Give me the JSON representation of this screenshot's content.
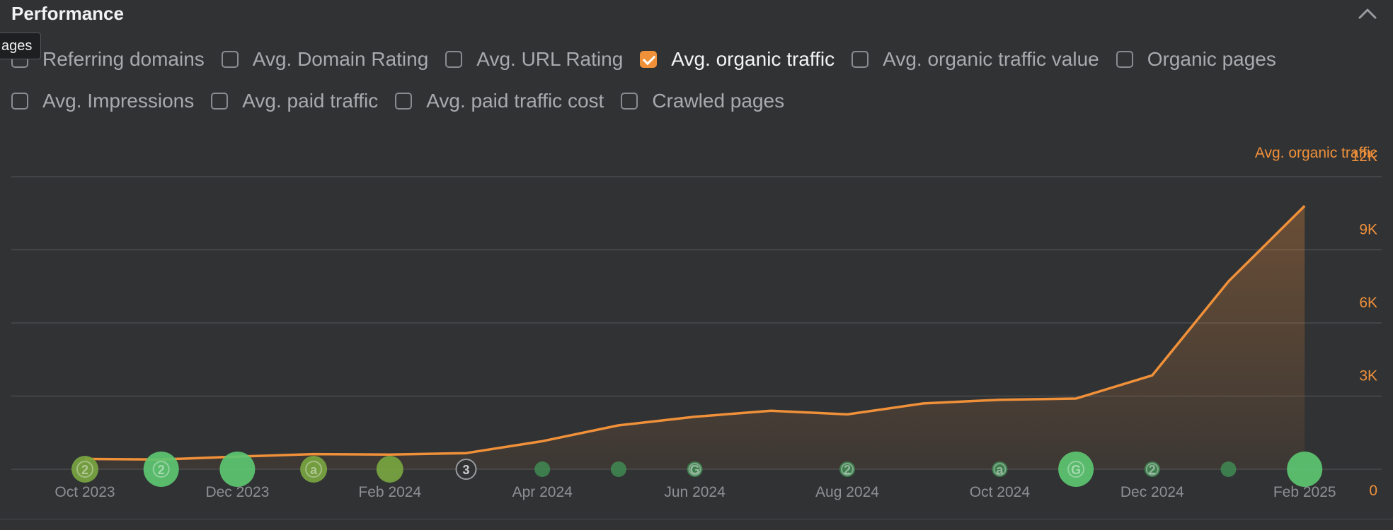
{
  "section": {
    "title": "Performance"
  },
  "tooltip_fragment": "ages",
  "metrics": [
    {
      "label": "Referring domains",
      "checked": false
    },
    {
      "label": "Avg. Domain Rating",
      "checked": false
    },
    {
      "label": "Avg. URL Rating",
      "checked": false
    },
    {
      "label": "Avg. organic traffic",
      "checked": true
    },
    {
      "label": "Avg. organic traffic value",
      "checked": false
    },
    {
      "label": "Organic pages",
      "checked": false
    },
    {
      "label": "Avg. Impressions",
      "checked": false
    },
    {
      "label": "Avg. paid traffic",
      "checked": false
    },
    {
      "label": "Avg. paid traffic cost",
      "checked": false
    },
    {
      "label": "Crawled pages",
      "checked": false
    }
  ],
  "colors": {
    "accent": "#f0913a",
    "marker_green": "#5cc571",
    "marker_dim_green": "#3f8a52",
    "marker_olive": "#77a540",
    "grid": "#4a4b4e",
    "axis_text": "#8e8f93"
  },
  "chart_data": {
    "type": "area",
    "series_name": "Avg. organic traffic",
    "x": [
      "Oct 2023",
      "Nov 2023",
      "Dec 2023",
      "Jan 2024",
      "Feb 2024",
      "Mar 2024",
      "Apr 2024",
      "May 2024",
      "Jun 2024",
      "Jul 2024",
      "Aug 2024",
      "Sep 2024",
      "Oct 2024",
      "Nov 2024",
      "Dec 2024",
      "Jan 2025",
      "Feb 2025"
    ],
    "x_tick_labels": [
      "Oct 2023",
      "Dec 2023",
      "Feb 2024",
      "Apr 2024",
      "Jun 2024",
      "Aug 2024",
      "Oct 2024",
      "Dec 2024",
      "Feb 2025"
    ],
    "values": [
      420,
      400,
      520,
      620,
      600,
      660,
      1150,
      1800,
      2150,
      2400,
      2250,
      2700,
      2850,
      2900,
      3850,
      7700,
      10800
    ],
    "y_ticks": [
      0,
      3000,
      6000,
      9000,
      12000
    ],
    "y_tick_labels": [
      "0",
      "3K",
      "6K",
      "9K",
      "12K"
    ],
    "ylim": [
      0,
      12000
    ],
    "y_axis_title": "Avg. organic traffic",
    "y_axis_side": "right",
    "grid": true,
    "annotations": [
      {
        "x": "Oct 2023",
        "label": "2",
        "size": "medium",
        "color": "olive"
      },
      {
        "x": "Nov 2023",
        "label": "2",
        "size": "large",
        "color": "green"
      },
      {
        "x": "Dec 2023",
        "label": "",
        "size": "large",
        "color": "green"
      },
      {
        "x": "Jan 2024",
        "label": "a",
        "size": "medium",
        "color": "olive"
      },
      {
        "x": "Feb 2024",
        "label": "",
        "size": "medium",
        "color": "olive"
      },
      {
        "x": "Mar 2024",
        "label": "3",
        "size": "outline",
        "color": "gray"
      },
      {
        "x": "Apr 2024",
        "label": "",
        "size": "small",
        "color": "dim"
      },
      {
        "x": "May 2024",
        "label": "",
        "size": "small",
        "color": "dim"
      },
      {
        "x": "Jun 2024",
        "label": "G",
        "size": "small",
        "color": "dim"
      },
      {
        "x": "Aug 2024",
        "label": "2",
        "size": "small",
        "color": "dim"
      },
      {
        "x": "Oct 2024",
        "label": "a",
        "size": "small",
        "color": "dim"
      },
      {
        "x": "Nov 2024",
        "label": "G",
        "size": "large",
        "color": "green"
      },
      {
        "x": "Dec 2024",
        "label": "2",
        "size": "small",
        "color": "dim"
      },
      {
        "x": "Jan 2025",
        "label": "",
        "size": "small",
        "color": "dim"
      },
      {
        "x": "Feb 2025",
        "label": "",
        "size": "large",
        "color": "green"
      }
    ]
  }
}
